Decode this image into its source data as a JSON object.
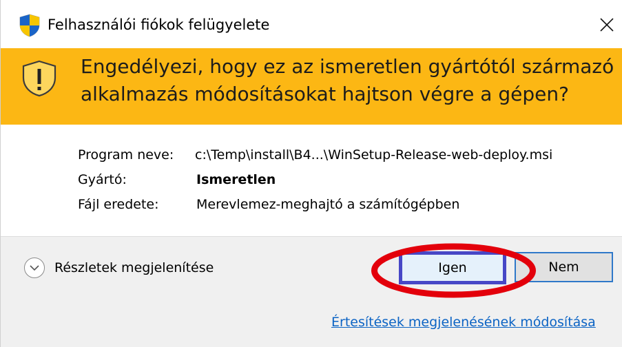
{
  "window": {
    "title": "Felhasználói fiókok felügyelete",
    "close_glyph": "✕"
  },
  "banner": {
    "question": "Engedélyezi, hogy ez az ismeretlen gyártótól származó alkalmazás módosításokat hajtson végre a gépen?",
    "icon": "warning-shield-icon",
    "color": "#fcb714"
  },
  "info": {
    "rows": [
      {
        "label": "Program neve:",
        "value": "c:\\Temp\\install\\B4...\\WinSetup-Release-web-deploy.msi"
      },
      {
        "label": "Gyártó:",
        "value": "Ismeretlen"
      },
      {
        "label": "Fájl eredete:",
        "value": "Merevlemez-meghajtó a számítógépben"
      }
    ]
  },
  "footer": {
    "details_label": "Részletek megjelenítése",
    "yes_label": "Igen",
    "no_label": "Nem",
    "notify_link": "Értesítések megjelenésének módosítása"
  },
  "colors": {
    "accent_link": "#0b63c4",
    "highlight_ring": "#e3000b",
    "yes_border": "#4747c6"
  }
}
